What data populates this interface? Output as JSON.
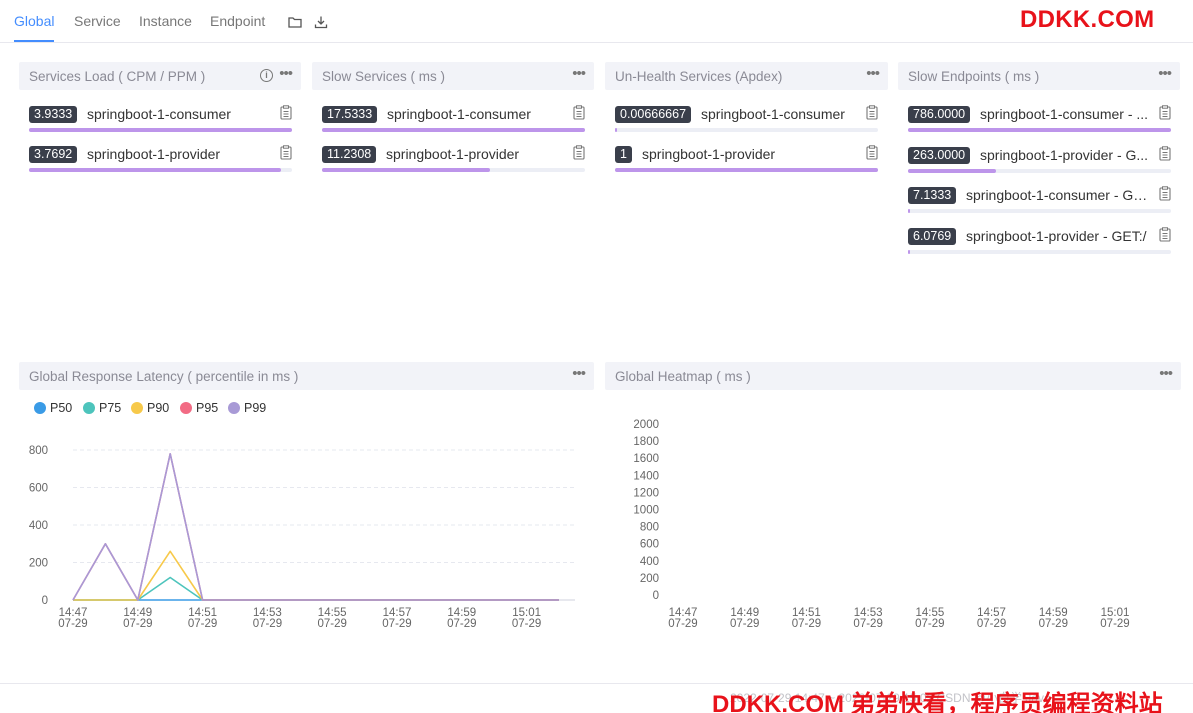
{
  "topbar": {
    "tabs": [
      {
        "label": "Global",
        "active": true
      },
      {
        "label": "Service",
        "active": false
      },
      {
        "label": "Instance",
        "active": false
      },
      {
        "label": "Endpoint",
        "active": false
      }
    ],
    "icons": [
      "folder-icon",
      "download-icon"
    ]
  },
  "watermark": {
    "top": "DDKK.COM",
    "bottom_brand": "DDKK.COM 弟弟快看，程序员编程资料站",
    "bottom_faint": "2022-07-29 14:47 ~ 2022-07-29 15:02  CSDN @小白学  Java"
  },
  "panels": {
    "services_load": {
      "title": "Services Load ( CPM / PPM )",
      "rows": [
        {
          "value": "3.9333",
          "label": "springboot-1-consumer",
          "fill": 1.0
        },
        {
          "value": "3.7692",
          "label": "springboot-1-provider",
          "fill": 0.958
        }
      ]
    },
    "slow_services": {
      "title": "Slow Services ( ms )",
      "rows": [
        {
          "value": "17.5333",
          "label": "springboot-1-consumer",
          "fill": 1.0
        },
        {
          "value": "11.2308",
          "label": "springboot-1-provider",
          "fill": 0.64
        }
      ]
    },
    "unhealth_services": {
      "title": "Un-Health Services (Apdex)",
      "rows": [
        {
          "value": "0.00666667",
          "label": "springboot-1-consumer",
          "fill": 0.007
        },
        {
          "value": "1",
          "label": "springboot-1-provider",
          "fill": 1.0
        }
      ]
    },
    "slow_endpoints": {
      "title": "Slow Endpoints ( ms )",
      "rows": [
        {
          "value": "786.0000",
          "label": "springboot-1-consumer - ...",
          "fill": 1.0
        },
        {
          "value": "263.0000",
          "label": "springboot-1-provider - G...",
          "fill": 0.335
        },
        {
          "value": "7.1333",
          "label": "springboot-1-consumer - GE...",
          "fill": 0.009
        },
        {
          "value": "6.0769",
          "label": "springboot-1-provider - GET:/",
          "fill": 0.008
        }
      ]
    },
    "latency": {
      "title": "Global Response Latency ( percentile in ms )"
    },
    "heatmap": {
      "title": "Global Heatmap ( ms )"
    }
  },
  "chart_data": [
    {
      "type": "line",
      "x": [
        "14:47",
        "14:48",
        "14:49",
        "14:50",
        "14:51",
        "14:52",
        "14:53",
        "14:54",
        "14:55",
        "14:56",
        "14:57",
        "14:58",
        "14:59",
        "15:00",
        "15:01",
        "15:02"
      ],
      "x_tick_labels": [
        {
          "time": "14:47",
          "date": "07-29"
        },
        {
          "time": "14:49",
          "date": "07-29"
        },
        {
          "time": "14:51",
          "date": "07-29"
        },
        {
          "time": "14:53",
          "date": "07-29"
        },
        {
          "time": "14:55",
          "date": "07-29"
        },
        {
          "time": "14:57",
          "date": "07-29"
        },
        {
          "time": "14:59",
          "date": "07-29"
        },
        {
          "time": "15:01",
          "date": "07-29"
        }
      ],
      "series": [
        {
          "name": "P50",
          "color": "#3a9be6",
          "values": [
            0,
            0,
            0,
            0,
            0,
            0,
            0,
            0,
            0,
            0,
            0,
            0,
            0,
            0,
            0,
            0
          ]
        },
        {
          "name": "P75",
          "color": "#4dc4bc",
          "values": [
            0,
            0,
            0,
            120,
            0,
            0,
            0,
            0,
            0,
            0,
            0,
            0,
            0,
            0,
            0,
            0
          ]
        },
        {
          "name": "P90",
          "color": "#f7c94a",
          "values": [
            0,
            0,
            0,
            260,
            0,
            0,
            0,
            0,
            0,
            0,
            0,
            0,
            0,
            0,
            0,
            0
          ]
        },
        {
          "name": "P95",
          "color": "#f26b84",
          "values": [
            0,
            300,
            0,
            780,
            0,
            0,
            0,
            0,
            0,
            0,
            0,
            0,
            0,
            0,
            0,
            0
          ]
        },
        {
          "name": "P99",
          "color": "#a89ad6",
          "values": [
            0,
            300,
            0,
            780,
            0,
            0,
            0,
            0,
            0,
            0,
            0,
            0,
            0,
            0,
            0,
            0
          ]
        }
      ],
      "y_ticks": [
        0,
        200,
        400,
        600,
        800
      ],
      "ylim": [
        0,
        800
      ],
      "grid": true,
      "legend": "top-left"
    },
    {
      "type": "heatmap",
      "x_tick_labels": [
        {
          "time": "14:47",
          "date": "07-29"
        },
        {
          "time": "14:49",
          "date": "07-29"
        },
        {
          "time": "14:51",
          "date": "07-29"
        },
        {
          "time": "14:53",
          "date": "07-29"
        },
        {
          "time": "14:55",
          "date": "07-29"
        },
        {
          "time": "14:57",
          "date": "07-29"
        },
        {
          "time": "14:59",
          "date": "07-29"
        },
        {
          "time": "15:01",
          "date": "07-29"
        }
      ],
      "y_ticks": [
        0,
        200,
        400,
        600,
        800,
        1000,
        1200,
        1400,
        1600,
        1800,
        2000
      ],
      "ylim": [
        0,
        2000
      ],
      "values": []
    }
  ]
}
